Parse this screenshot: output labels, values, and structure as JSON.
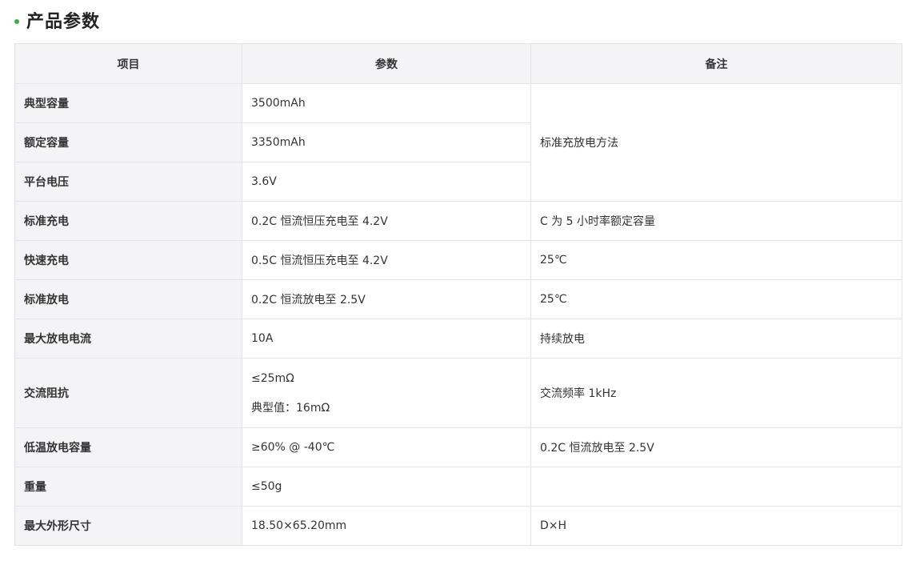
{
  "section": {
    "title": "产品参数"
  },
  "table": {
    "headers": [
      "项目",
      "参数",
      "备注"
    ],
    "rows": [
      {
        "item": "典型容量",
        "param": "3500mAh"
      },
      {
        "item": "额定容量",
        "param": "3350mAh"
      },
      {
        "item": "平台电压",
        "param": "3.6V"
      },
      {
        "item": "标准充电",
        "param": "0.2C 恒流恒压充电至 4.2V",
        "note": "C 为 5 小时率额定容量"
      },
      {
        "item": "快速充电",
        "param": "0.5C 恒流恒压充电至 4.2V",
        "note": "25℃"
      },
      {
        "item": "标准放电",
        "param": "0.2C 恒流放电至 2.5V",
        "note": "25℃"
      },
      {
        "item": "最大放电电流",
        "param": "10A",
        "note": "持续放电"
      },
      {
        "item": "交流阻抗",
        "param_lines": [
          "≤25mΩ",
          "典型值：16mΩ"
        ],
        "note": "交流频率 1kHz"
      },
      {
        "item": "低温放电容量",
        "param": "≥60% @ -40℃",
        "note": "0.2C 恒流放电至 2.5V"
      },
      {
        "item": "重量",
        "param": "≤50g",
        "note": ""
      },
      {
        "item": "最大外形尺寸",
        "param": "18.50×65.20mm",
        "note": "D×H"
      }
    ],
    "merged_note": "标准充放电方法"
  },
  "colors": {
    "accent_dot": "#3fae49",
    "header_bg": "#f4f4f7",
    "border": "#e4e4e4"
  }
}
